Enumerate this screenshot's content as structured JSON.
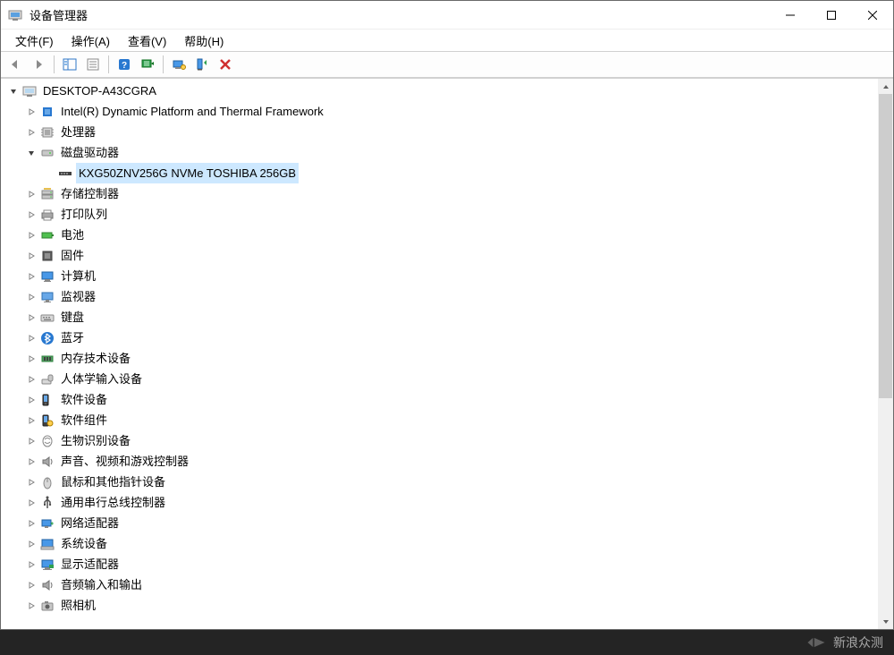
{
  "window": {
    "title": "设备管理器"
  },
  "menubar": {
    "file": "文件(F)",
    "action": "操作(A)",
    "view": "查看(V)",
    "help": "帮助(H)"
  },
  "tree": {
    "root": "DESKTOP-A43CGRA",
    "items": [
      {
        "label": "Intel(R) Dynamic Platform and Thermal Framework",
        "icon": "chip-blue",
        "expander": "closed"
      },
      {
        "label": "处理器",
        "icon": "cpu",
        "expander": "closed"
      },
      {
        "label": "磁盘驱动器",
        "icon": "disk",
        "expander": "open"
      },
      {
        "label": "KXG50ZNV256G NVMe TOSHIBA 256GB",
        "icon": "ssd",
        "expander": "none",
        "indent": 2,
        "selected": true
      },
      {
        "label": "存储控制器",
        "icon": "storage-ctrl",
        "expander": "closed"
      },
      {
        "label": "打印队列",
        "icon": "printer",
        "expander": "closed"
      },
      {
        "label": "电池",
        "icon": "battery",
        "expander": "closed"
      },
      {
        "label": "固件",
        "icon": "firmware",
        "expander": "closed"
      },
      {
        "label": "计算机",
        "icon": "computer",
        "expander": "closed"
      },
      {
        "label": "监视器",
        "icon": "monitor",
        "expander": "closed"
      },
      {
        "label": "键盘",
        "icon": "keyboard",
        "expander": "closed"
      },
      {
        "label": "蓝牙",
        "icon": "bluetooth",
        "expander": "closed"
      },
      {
        "label": "内存技术设备",
        "icon": "memory",
        "expander": "closed"
      },
      {
        "label": "人体学输入设备",
        "icon": "hid",
        "expander": "closed"
      },
      {
        "label": "软件设备",
        "icon": "software",
        "expander": "closed"
      },
      {
        "label": "软件组件",
        "icon": "software-comp",
        "expander": "closed"
      },
      {
        "label": "生物识别设备",
        "icon": "biometric",
        "expander": "closed"
      },
      {
        "label": "声音、视频和游戏控制器",
        "icon": "sound",
        "expander": "closed"
      },
      {
        "label": "鼠标和其他指针设备",
        "icon": "mouse",
        "expander": "closed"
      },
      {
        "label": "通用串行总线控制器",
        "icon": "usb",
        "expander": "closed"
      },
      {
        "label": "网络适配器",
        "icon": "network",
        "expander": "closed"
      },
      {
        "label": "系统设备",
        "icon": "system",
        "expander": "closed"
      },
      {
        "label": "显示适配器",
        "icon": "display",
        "expander": "closed"
      },
      {
        "label": "音频输入和输出",
        "icon": "audio-io",
        "expander": "closed"
      },
      {
        "label": "照相机",
        "icon": "camera",
        "expander": "closed"
      }
    ]
  },
  "watermark": {
    "text": "新浪众测"
  }
}
